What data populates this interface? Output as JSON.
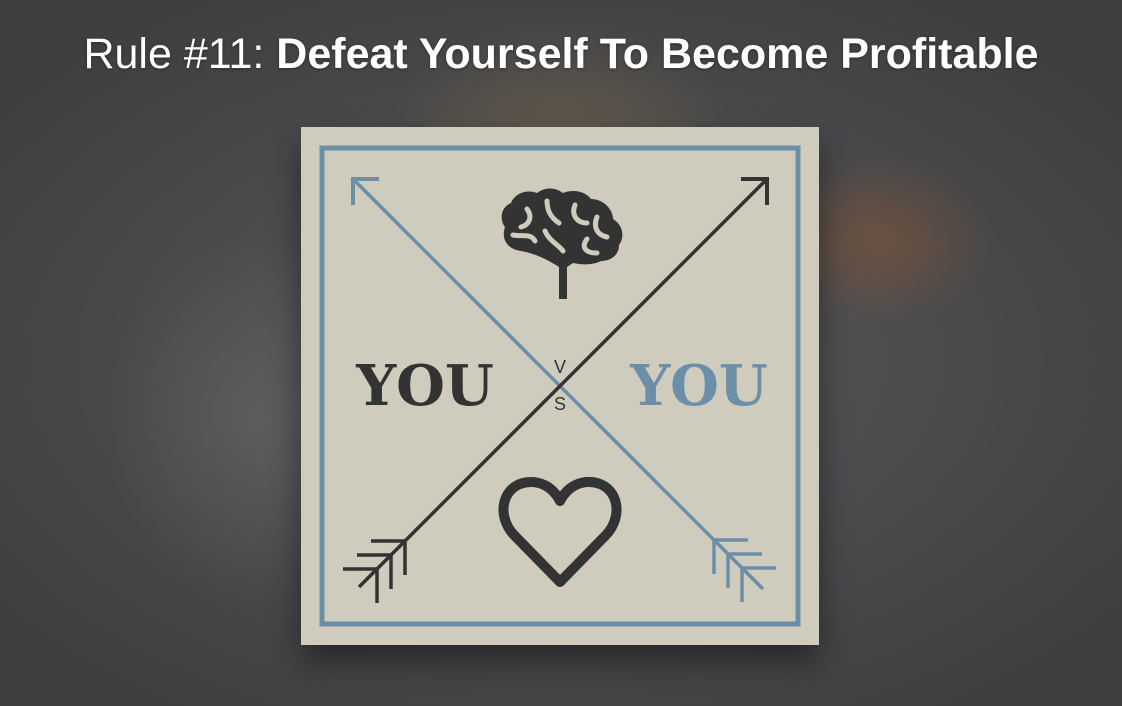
{
  "title": {
    "prefix": "Rule #11:",
    "main": "Defeat Yourself To Become Profitable"
  },
  "graphic": {
    "left_label": "YOU",
    "right_label": "YOU",
    "vs_top": "V",
    "vs_bottom": "S",
    "icons": [
      "brain-icon",
      "heart-icon",
      "arrow-icon"
    ]
  },
  "colors": {
    "background": "#4a4a4c",
    "card": "#cfcbbd",
    "dark": "#333333",
    "blue": "#6b8fa9",
    "title_text": "#ffffff"
  }
}
